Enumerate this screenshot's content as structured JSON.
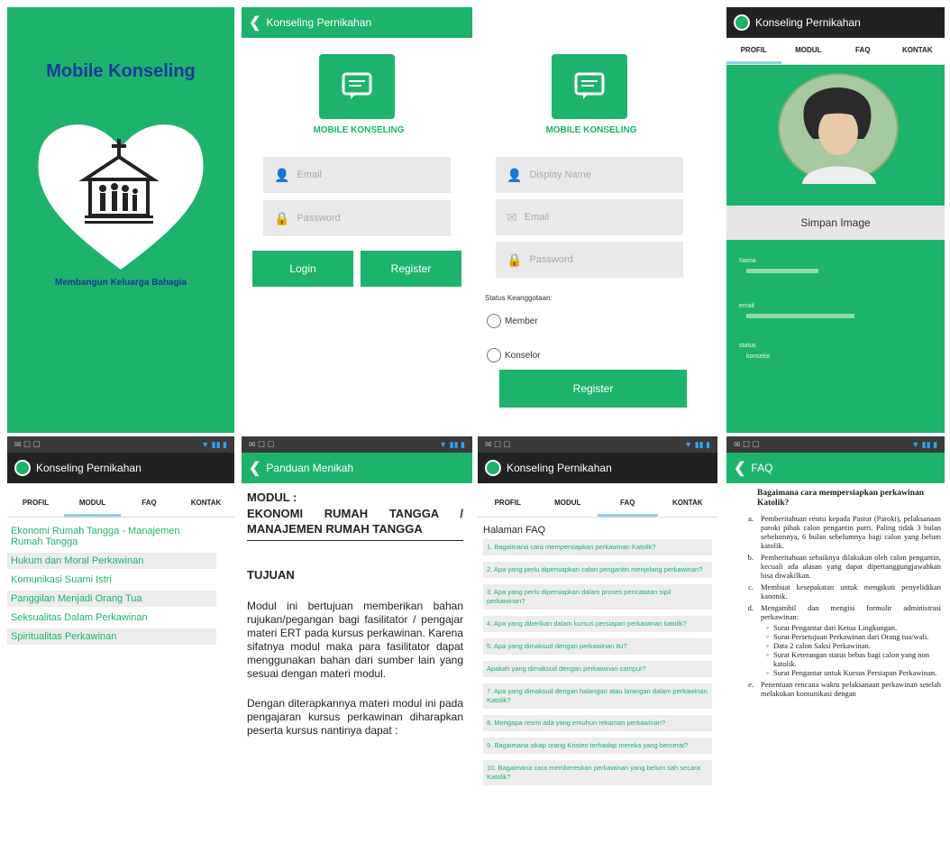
{
  "splash": {
    "title": "Mobile Konseling",
    "tagline": "Membangun Keluarga Bahagia"
  },
  "login": {
    "appbar_title": "Konseling Pernikahan",
    "logo_caption": "MOBILE KONSELING",
    "email_placeholder": "Email",
    "password_placeholder": "Password",
    "login_label": "Login",
    "register_label": "Register"
  },
  "register": {
    "logo_caption": "MOBILE KONSELING",
    "display_name_placeholder": "Display Name",
    "email_placeholder": "Email",
    "password_placeholder": "Password",
    "status_label": "Status Keanggotaan:",
    "option_member": "Member",
    "option_konselor": "Konselor",
    "register_label": "Register"
  },
  "profile": {
    "appbar_title": "Konseling Pernikahan",
    "tabs": [
      "PROFIL",
      "MODUL",
      "FAQ",
      "KONTAK"
    ],
    "save_image_label": "Simpan Image",
    "name_label": "Nama",
    "email_label": "email",
    "status_label": "status",
    "status_value": "konselor"
  },
  "modul_list": {
    "appbar_title": "Konseling Pernikahan",
    "tabs": [
      "PROFIL",
      "MODUL",
      "FAQ",
      "KONTAK"
    ],
    "items": [
      "Ekonomi Rumah Tangga - Manajemen Rumah Tangga",
      "Hukum dan Moral Perkawinan",
      "Komunikasi Suami Istri",
      "Panggilan Menjadi Orang Tua",
      "Seksualitas Dalam Perkawinan",
      "Spiritualitas Perkawinan"
    ]
  },
  "modul_detail": {
    "appbar_title": "Panduan Menikah",
    "heading": "MODUL :",
    "subheading": "EKONOMI RUMAH TANGGA / MANAJEMEN RUMAH TANGGA",
    "section": "TUJUAN",
    "para1": "Modul ini bertujuan memberikan bahan rujukan/pegangan bagi fasilitator / pengajar materi ERT pada kursus perkawinan. Karena sifatnya modul maka para fasilitator dapat menggunakan bahan dari sumber lain yang sesuai dengan materi modul.",
    "para2": "Dengan diterapkannya materi modul ini pada pengajaran kursus perkawinan diharapkan peserta kursus nantinya dapat :"
  },
  "faq_list": {
    "appbar_title": "Konseling Pernikahan",
    "tabs": [
      "PROFIL",
      "MODUL",
      "FAQ",
      "KONTAK"
    ],
    "page_title": "Halaman FAQ",
    "items": [
      "1. Bagaimana cara mempersiapkan perkawinan Katolik?",
      "2. Apa yang perlu dipersiapkan calon pengantin menjelang perkawinan?",
      "3. Apa yang perlu dipersiapkan dalam proses pencatatan sipil perkawinan?",
      "4. Apa yang diberikan dalam kursus persiapan perkawinan katolik?",
      "5. Apa yang dimaksud dengan perkawinan itu?",
      "Apakah yang dimaksud dengan perkawinan campur?",
      "7. Apa yang dimaksud dengan halangan atau larangan dalam perkawinan Katolik?",
      "8. Mengapa resmi ada yang emuhun rekaman perkawinan?",
      "9. Bagaimana sikap orang Kristen terhadap mereka yang bercerai?",
      "10. Bagaimana cara membereskan perkawinan yang belum sah secara Katolik?"
    ]
  },
  "faq_detail": {
    "appbar_title": "FAQ",
    "question": "Bagaimana cara mempersiapkan perkawinan Katolik?",
    "items": [
      {
        "marker": "a.",
        "text": "Pemberitahuan resmi kepada Pastor (Paroki), pelaksanaan paroki pihak calon pengantin putri. Paling tidak 3 bulan sebelumnya, 6 bulan sebelumnya bagi calon yang belum katolik."
      },
      {
        "marker": "b.",
        "text": "Pemberitahuan sebaiknya dilakukan oleh calon pengantin, kecuali ada alasan yang dapat dipertanggungjawabkan bisa diwakilkan."
      },
      {
        "marker": "c.",
        "text": "Membuat kesepakatan untuk mengikuti penyelidikan kanonik."
      },
      {
        "marker": "d.",
        "text": "Mengambil dan mengisi formulir administrasi perkawinan:"
      }
    ],
    "subitems": [
      "Surat Pengantar dari Ketua Lingkungan.",
      "Surat Persetujuan Perkawinan dari Orang tua/wali.",
      "Data 2 calon Saksi Perkawinan.",
      "Surat Keterangan status bebas bagi calon yang non katolik.",
      "Surat Pengantar untuk Kursus Persiapan Perkawinan."
    ],
    "last_item": {
      "marker": "e.",
      "text": "Penentuan rencana waktu pelaksanaan perkawinan setelah melakukan komunikasi dengan"
    }
  }
}
